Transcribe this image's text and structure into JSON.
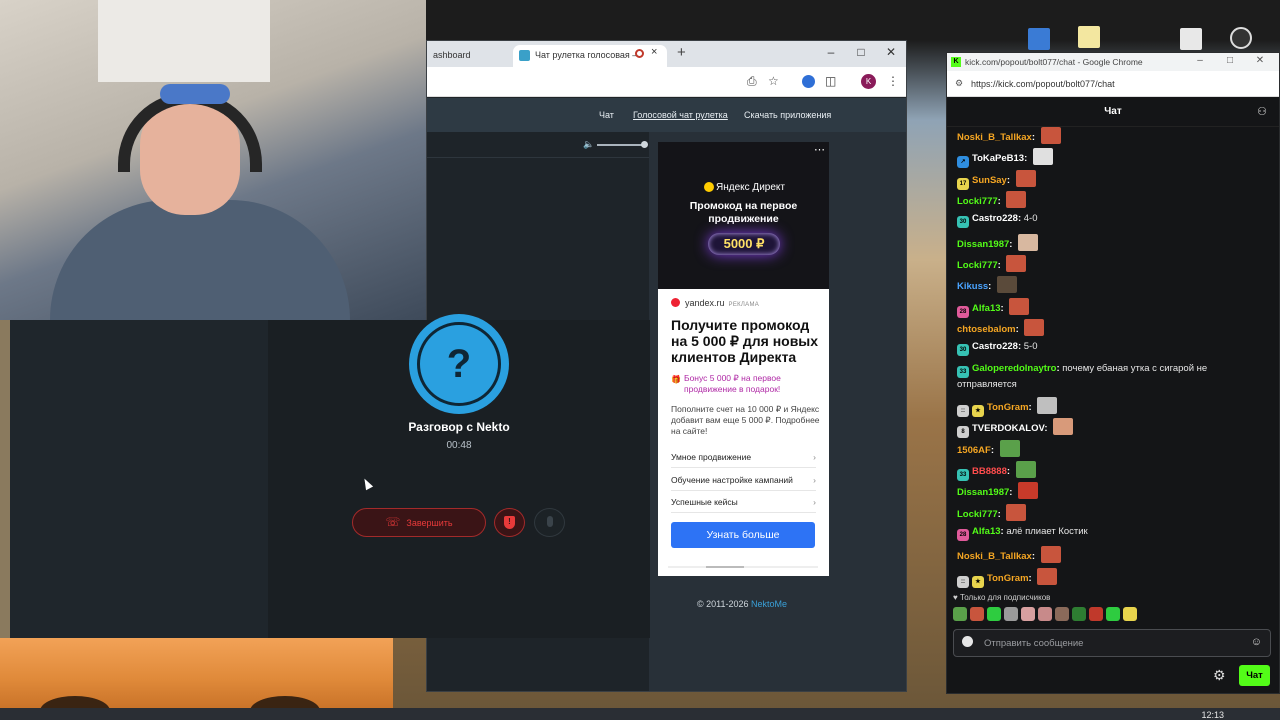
{
  "nekto_browser": {
    "tab_inactive": "ashboard",
    "tab_active": "Чат рулетка голосовая —",
    "tab_close": "×",
    "new_tab": "+",
    "nav_links": [
      "Чат",
      "Голосовой чат рулетка",
      "Скачать приложения"
    ],
    "profile_letter": "K",
    "footer_text": "© 2011-2026",
    "footer_link": "NektoMe"
  },
  "ad": {
    "brand": "Яндекс Директ",
    "headline": "Промокод на первое продвижение",
    "amount": "5000 ₽",
    "source": "yandex.ru",
    "source_label": "РЕКЛАМА",
    "title": "Получите промокод на 5 000 ₽ для новых клиентов Директа",
    "bonus": "Бонус 5 000 ₽ на первое продвижение в подарок!",
    "body": "Пополните счет на 10 000 ₽ и Яндекс добавит вам еще 5 000 ₽. Подробнее на сайте!",
    "links": [
      "Умное продвижение",
      "Обучение настройке кампаний",
      "Успешные кейсы"
    ],
    "cta": "Узнать больше",
    "carousel_progress": 0.25
  },
  "call": {
    "avatar_glyph": "?",
    "title": "Разговор с Nekto",
    "timer": "00:48",
    "end_button": "Завершить"
  },
  "kick": {
    "window_title": "kick.com/popout/bolt077/chat - Google Chrome",
    "url": "https://kick.com/popout/bolt077/chat",
    "header": "Чат",
    "subs_only": "Только для подписчиков",
    "input_placeholder": "Отправить сообщение",
    "send_button": "Чат",
    "messages": [
      {
        "user": "Noski_B_Tallkax",
        "color": "#f5a623",
        "badges": [],
        "text": "",
        "emote": "#c8553d"
      },
      {
        "user": "ToKaPeB13",
        "color": "#ffffff",
        "badges": [
          {
            "bg": "#2f8ee0",
            "t": "↗"
          }
        ],
        "text": "",
        "emote": "#e0e0e0"
      },
      {
        "user": "SunSay",
        "color": "#f5a623",
        "badges": [
          {
            "bg": "#e8d44d",
            "t": "17"
          }
        ],
        "text": "",
        "emote": "#c8553d"
      },
      {
        "user": "Locki777",
        "color": "#53fc18",
        "badges": [],
        "text": "",
        "emote": "#c8553d"
      },
      {
        "user": "Castro228",
        "color": "#ffffff",
        "badges": [
          {
            "bg": "#36c2b4",
            "t": "30"
          }
        ],
        "text": "4-0",
        "emote": ""
      },
      {
        "user": "Dissan1987",
        "color": "#53fc18",
        "badges": [],
        "text": "",
        "emote": "#d8b8a0"
      },
      {
        "user": "Locki777",
        "color": "#53fc18",
        "badges": [],
        "text": "",
        "emote": "#c8553d"
      },
      {
        "user": "Kikuss",
        "color": "#4aa3ff",
        "badges": [],
        "text": "",
        "emote": "#5a4a3a"
      },
      {
        "user": "Alfa13",
        "color": "#53fc18",
        "badges": [
          {
            "bg": "#e05a9a",
            "t": "28"
          }
        ],
        "text": "",
        "emote": "#c8553d"
      },
      {
        "user": "chtosebalom",
        "color": "#f5a623",
        "badges": [],
        "text": "",
        "emote": "#c8553d"
      },
      {
        "user": "Castro228",
        "color": "#ffffff",
        "badges": [
          {
            "bg": "#36c2b4",
            "t": "30"
          }
        ],
        "text": "5-0",
        "emote": ""
      },
      {
        "user": "Galoperedolnaytro",
        "color": "#53fc18",
        "badges": [
          {
            "bg": "#36c2b4",
            "t": "33"
          }
        ],
        "text": "почему ебаная утка с сигарой не отправляется",
        "emote": ""
      },
      {
        "user": "TonGram",
        "color": "#f5a623",
        "badges": [
          {
            "bg": "#cfcfcf",
            "t": "::"
          },
          {
            "bg": "#e8d44d",
            "t": "★"
          }
        ],
        "text": "",
        "emote": "#bfbfbf"
      },
      {
        "user": "TVERDOKALOV",
        "color": "#ffffff",
        "badges": [
          {
            "bg": "#cfcfcf",
            "t": "8"
          }
        ],
        "text": "",
        "emote": "#d89a7a"
      },
      {
        "user": "1506AF",
        "color": "#f5a623",
        "badges": [],
        "text": "",
        "emote": "#5aa04a"
      },
      {
        "user": "BB8888",
        "color": "#ff4d4d",
        "badges": [
          {
            "bg": "#36c2b4",
            "t": "33"
          }
        ],
        "text": "",
        "emote": "#5aa04a"
      },
      {
        "user": "Dissan1987",
        "color": "#53fc18",
        "badges": [],
        "text": "",
        "emote": "#c83a2a"
      },
      {
        "user": "Locki777",
        "color": "#53fc18",
        "badges": [],
        "text": "",
        "emote": "#c8553d"
      },
      {
        "user": "Alfa13",
        "color": "#53fc18",
        "badges": [
          {
            "bg": "#e05a9a",
            "t": "28"
          }
        ],
        "text": "алё плиает Костик",
        "emote": ""
      },
      {
        "user": "Noski_B_Tallkax",
        "color": "#f5a623",
        "badges": [],
        "text": "",
        "emote": "#c8553d"
      },
      {
        "user": "TonGram",
        "color": "#f5a623",
        "badges": [
          {
            "bg": "#cfcfcf",
            "t": "::"
          },
          {
            "bg": "#e8d44d",
            "t": "★"
          }
        ],
        "text": "",
        "emote": "#c8553d"
      }
    ],
    "emote_bar": [
      "#5aa04a",
      "#c8553d",
      "#2ecc40",
      "#9a9a9a",
      "#d8a0a0",
      "#c88a8a",
      "#8a6a5a",
      "#2e7d32",
      "#c0392b",
      "#2ecc40",
      "#e8d44d"
    ]
  },
  "taskbar": {
    "clock": "12:13"
  }
}
